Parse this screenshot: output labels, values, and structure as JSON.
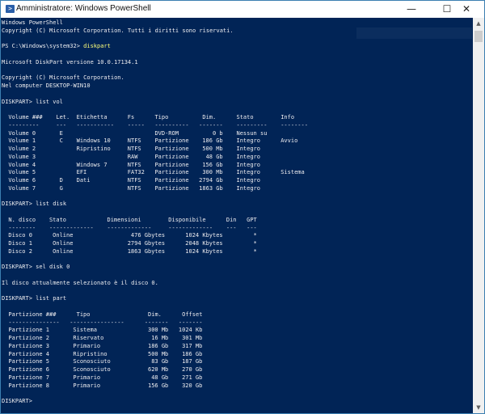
{
  "window": {
    "title": "Amministratore: Windows PowerShell",
    "minimize": "—",
    "maximize": "☐",
    "close": "✕"
  },
  "colors": {
    "background": "#012456",
    "text": "#eeedf0",
    "command": "#ffff7a"
  },
  "header": {
    "line1": "Windows PowerShell",
    "line2": "Copyright (C) Microsoft Corporation. Tutti i diritti sono riservati.",
    "ps_prompt": "PS C:\\Windows\\system32> ",
    "ps_command": "diskpart",
    "version": "Microsoft DiskPart versione 10.0.17134.1",
    "copyright": "Copyright (C) Microsoft Corporation.",
    "computer": "Nel computer DESKTOP-WIN10"
  },
  "prompt": "DISKPART> ",
  "commands": [
    "list vol",
    "list disk",
    "sel disk 0",
    "list part"
  ],
  "sel_message": "Il disco attualmente selezionato è il disco 0.",
  "volumes": {
    "headers": [
      "Volume ###",
      "Let.",
      "Etichetta",
      "Fs",
      "Tipo",
      "Dim.",
      "Stato",
      "Info"
    ],
    "dashes": [
      "---------",
      "---",
      "-----------",
      "-----",
      "----------",
      "-------",
      "---------",
      "--------"
    ],
    "rows": [
      [
        "Volume 0",
        "E",
        "",
        "",
        "DVD-ROM",
        "0 b",
        "Nessun su",
        ""
      ],
      [
        "Volume 1",
        "C",
        "Windows 10",
        "NTFS",
        "Partizione",
        "186 Gb",
        "Integro",
        "Avvio"
      ],
      [
        "Volume 2",
        "",
        "Ripristino",
        "NTFS",
        "Partizione",
        "500 Mb",
        "Integro",
        ""
      ],
      [
        "Volume 3",
        "",
        "",
        "RAW",
        "Partizione",
        "48 Gb",
        "Integro",
        ""
      ],
      [
        "Volume 4",
        "",
        "Windows 7",
        "NTFS",
        "Partizione",
        "156 Gb",
        "Integro",
        ""
      ],
      [
        "Volume 5",
        "",
        "EFI",
        "FAT32",
        "Partizione",
        "300 Mb",
        "Integro",
        "Sistema"
      ],
      [
        "Volume 6",
        "D",
        "Dati",
        "NTFS",
        "Partizione",
        "2794 Gb",
        "Integro",
        ""
      ],
      [
        "Volume 7",
        "G",
        "",
        "NTFS",
        "Partizione",
        "1863 Gb",
        "Integro",
        ""
      ]
    ]
  },
  "disks": {
    "headers": [
      "N. disco",
      "Stato",
      "Dimensioni",
      "Disponibile",
      "Din",
      "GPT"
    ],
    "dashes": [
      "--------",
      "-------------",
      "-------------",
      "-------------",
      "---",
      "---"
    ],
    "rows": [
      [
        "Disco 0",
        "Online",
        "476 Gbytes",
        "1024 Kbytes",
        "",
        "*"
      ],
      [
        "Disco 1",
        "Online",
        "2794 Gbytes",
        "2048 Kbytes",
        "",
        "*"
      ],
      [
        "Disco 2",
        "Online",
        "1863 Gbytes",
        "1024 Kbytes",
        "",
        "*"
      ]
    ]
  },
  "partitions": {
    "headers": [
      "Partizione ###",
      "Tipo",
      "Dim.",
      "Offset"
    ],
    "dashes": [
      "---------------",
      "----------------",
      "-------",
      "-------"
    ],
    "rows": [
      [
        "Partizione 1",
        "Sistema",
        "300 Mb",
        "1024 Kb"
      ],
      [
        "Partizione 2",
        "Riservato",
        "16 Mb",
        "301 Mb"
      ],
      [
        "Partizione 3",
        "Primario",
        "186 Gb",
        "317 Mb"
      ],
      [
        "Partizione 4",
        "Ripristino",
        "500 Mb",
        "186 Gb"
      ],
      [
        "Partizione 5",
        "Sconosciuto",
        "83 Gb",
        "187 Gb"
      ],
      [
        "Partizione 6",
        "Sconosciuto",
        "620 Mb",
        "270 Gb"
      ],
      [
        "Partizione 7",
        "Primario",
        "48 Gb",
        "271 Gb"
      ],
      [
        "Partizione 8",
        "Primario",
        "156 Gb",
        "320 Gb"
      ]
    ]
  }
}
